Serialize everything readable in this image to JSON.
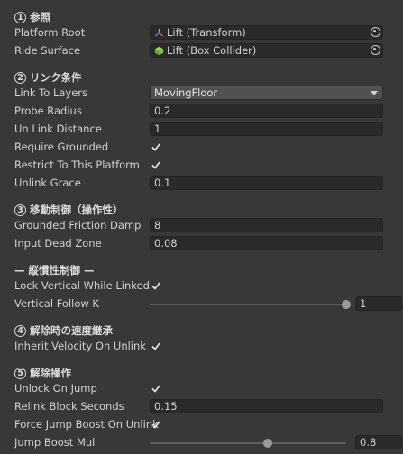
{
  "sections": {
    "s1": {
      "num": "1",
      "title": "参照"
    },
    "s2": {
      "num": "2",
      "title": "リンク条件"
    },
    "s3": {
      "num": "3",
      "title": "移動制御（操作性）"
    },
    "sub": {
      "title": "— 縦慣性制御 —"
    },
    "s4": {
      "num": "4",
      "title": "解除時の速度継承"
    },
    "s5": {
      "num": "5",
      "title": "解除操作"
    }
  },
  "fields": {
    "platform_root": {
      "label": "Platform Root",
      "value": "Lift (Transform)",
      "icon": "transform-icon"
    },
    "ride_surface": {
      "label": "Ride Surface",
      "value": "Lift (Box Collider)",
      "icon": "box-collider-icon"
    },
    "link_to_layers": {
      "label": "Link To Layers",
      "value": "MovingFloor"
    },
    "probe_radius": {
      "label": "Probe Radius",
      "value": "0.2"
    },
    "unlink_distance": {
      "label": "Un Link Distance",
      "value": "1"
    },
    "require_grounded": {
      "label": "Require Grounded",
      "checked": true
    },
    "restrict_platform": {
      "label": "Restrict To This Platform",
      "checked": true
    },
    "unlink_grace": {
      "label": "Unlink Grace",
      "value": "0.1"
    },
    "grounded_friction": {
      "label": "Grounded Friction Damp",
      "value": "8"
    },
    "input_dead_zone": {
      "label": "Input Dead Zone",
      "value": "0.08"
    },
    "lock_vertical": {
      "label": "Lock Vertical While Linked",
      "checked": true
    },
    "vertical_follow": {
      "label": "Vertical Follow K",
      "value": "1",
      "fraction": 1.0
    },
    "inherit_velocity": {
      "label": "Inherit Velocity On Unlink",
      "checked": true
    },
    "unlock_on_jump": {
      "label": "Unlock On Jump",
      "checked": true
    },
    "relink_block": {
      "label": "Relink Block Seconds",
      "value": "0.15"
    },
    "force_jump_boost": {
      "label": "Force Jump Boost On Unlink",
      "checked": true
    },
    "jump_boost_mul": {
      "label": "Jump Boost Mul",
      "value": "0.8",
      "fraction": 0.6
    }
  },
  "colors": {
    "background": "#383838",
    "field": "#2a2a2a",
    "text": "#d2d2d2"
  }
}
